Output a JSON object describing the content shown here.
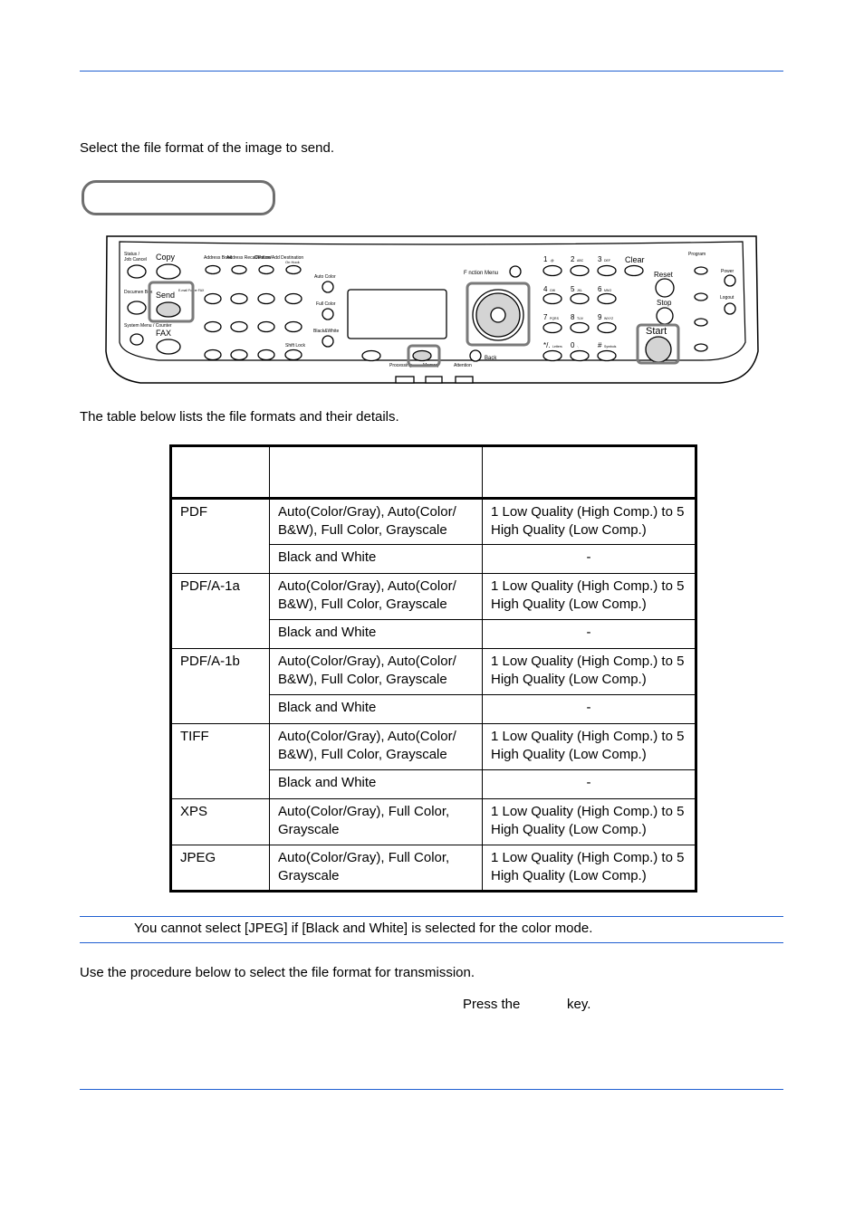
{
  "intro": "Select the file format of the image to send.",
  "panel": {
    "labels": {
      "status": "Status /",
      "job_cancel": "Job Cancel",
      "copy": "Copy",
      "document_box": "Documen Box",
      "send": "Send",
      "send_sub": "E-mail Folder FAX",
      "system_menu": "System Menu / Counter",
      "fax": "FAX",
      "address_book": "Address Book",
      "address_recall": "Address Recall/Pause",
      "confirm_add": "Confirm/Add Destination",
      "on_hook": "On Hook",
      "auto_color": "Auto Color",
      "full_color": "Full Color",
      "black_white": "Black&White",
      "function_menu": "F nction Menu",
      "ok": "OK",
      "back": "Back",
      "processing": "Processing",
      "memory": "Memory",
      "attention": "Attention",
      "clear": "Clear",
      "reset": "Reset",
      "stop": "Stop",
      "start": "Start",
      "program": "Program",
      "power": "Power",
      "logout": "Logout",
      "shift_lock": "Shift Lock",
      "keys": [
        "1",
        "2",
        "3",
        "4",
        "5",
        "6",
        "7",
        "8",
        "9",
        "*/.",
        "0",
        "#"
      ],
      "key_subs": [
        ".@",
        "ABC",
        "DEF",
        "GHI",
        "JKL",
        "MNO",
        "PQRS",
        "TUV",
        "WXYZ",
        "Letters",
        "·,",
        "Symbols"
      ]
    },
    "highlight_color": "#7a7a7a"
  },
  "table_intro": "The table below lists the file formats and their details.",
  "table": {
    "headers": [
      "",
      "",
      ""
    ],
    "rows": [
      {
        "format": "PDF",
        "modes": [
          "Auto(Color/Gray), Auto(Color/ B&W), Full Color, Grayscale",
          "Black and White"
        ],
        "quality": [
          "1 Low Quality (High Comp.) to 5 High Quality (Low Comp.)",
          "-"
        ]
      },
      {
        "format": "PDF/A-1a",
        "modes": [
          "Auto(Color/Gray), Auto(Color/ B&W), Full Color, Grayscale",
          "Black and White"
        ],
        "quality": [
          "1 Low Quality (High Comp.) to 5 High Quality (Low Comp.)",
          "-"
        ]
      },
      {
        "format": "PDF/A-1b",
        "modes": [
          "Auto(Color/Gray), Auto(Color/ B&W), Full Color, Grayscale",
          "Black and White"
        ],
        "quality": [
          "1 Low Quality (High Comp.) to 5 High Quality (Low Comp.)",
          "-"
        ]
      },
      {
        "format": "TIFF",
        "modes": [
          "Auto(Color/Gray), Auto(Color/ B&W), Full Color, Grayscale",
          "Black and White"
        ],
        "quality": [
          "1 Low Quality (High Comp.) to 5 High Quality (Low Comp.)",
          "-"
        ]
      },
      {
        "format": "XPS",
        "modes": [
          "Auto(Color/Gray), Full Color, Grayscale"
        ],
        "quality": [
          "1 Low Quality (High Comp.) to 5 High Quality (Low Comp.)"
        ]
      },
      {
        "format": "JPEG",
        "modes": [
          "Auto(Color/Gray), Full Color, Grayscale"
        ],
        "quality": [
          "1 Low Quality (High Comp.) to 5 High Quality (Low Comp.)"
        ]
      }
    ]
  },
  "note": "You cannot select [JPEG] if [Black and White] is selected for the color mode.",
  "procedure_intro": "Use the procedure below to select the file format for transmission.",
  "step1": {
    "prefix": "Press the",
    "suffix": "key."
  },
  "rule_color": "#1f5fd1"
}
